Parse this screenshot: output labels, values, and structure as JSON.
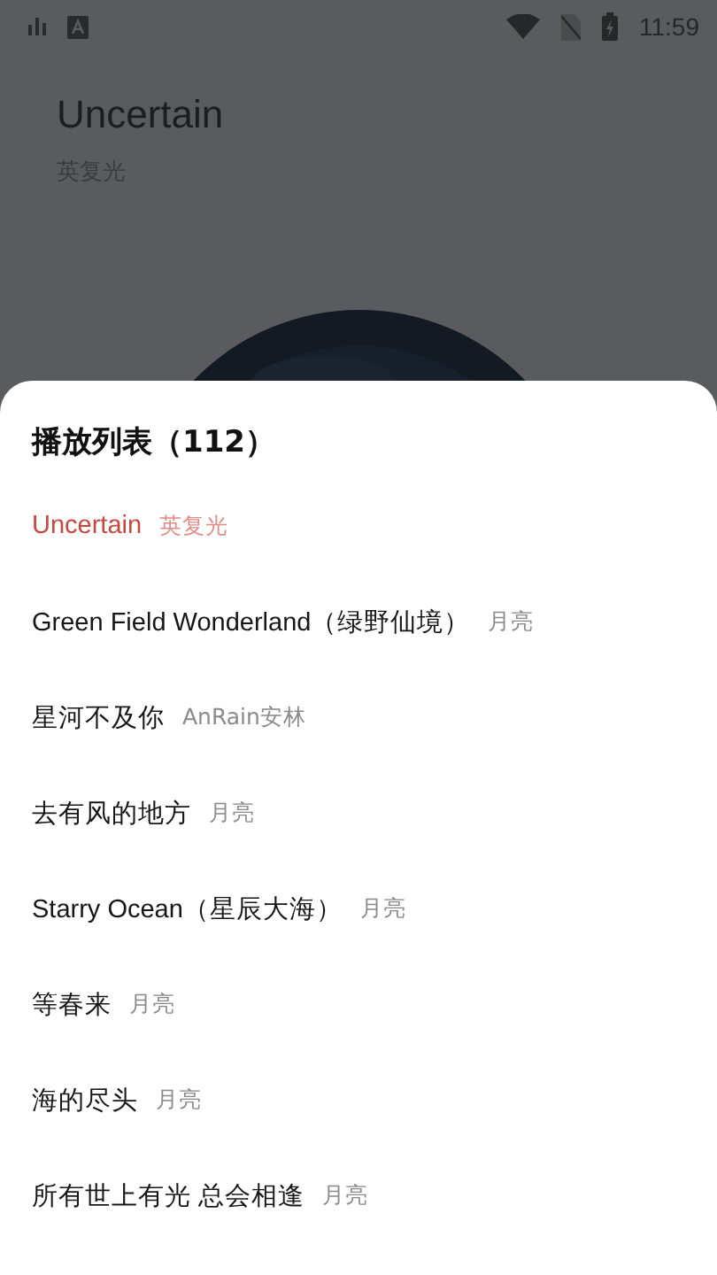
{
  "status_bar": {
    "time": "11:59"
  },
  "now_playing": {
    "title": "Uncertain",
    "artist": "英复光",
    "kind": "picture"
  },
  "playlist": {
    "title": "播放列表（112）",
    "songs": [
      {
        "title": "Uncertain",
        "artist": "英复光",
        "selected": true
      },
      {
        "title": "Green Field Wonderland（绿野仙境）",
        "artist": "月亮",
        "selected": false
      },
      {
        "title": "星河不及你",
        "artist": "AnRain安林",
        "selected": false
      },
      {
        "title": "去有风的地方",
        "artist": "月亮",
        "selected": false
      },
      {
        "title": "Starry Ocean（星辰大海）",
        "artist": "月亮",
        "selected": false
      },
      {
        "title": "等春来",
        "artist": "月亮",
        "selected": false
      },
      {
        "title": "海的尽头",
        "artist": "月亮",
        "selected": false
      },
      {
        "title": "所有世上有光 总会相逢",
        "artist": "月亮",
        "selected": false
      }
    ]
  }
}
